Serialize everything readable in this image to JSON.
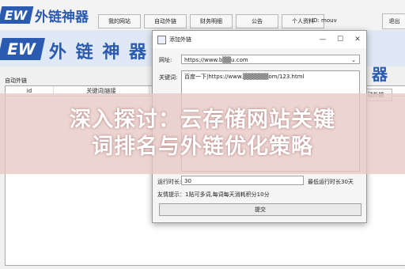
{
  "logo": {
    "badge": "EW",
    "text": "外链神器"
  },
  "tabs": [
    "我的网站",
    "自动外链",
    "财务明细",
    "公告",
    "个人资料"
  ],
  "user_id": "ID: mouv",
  "exit_label": "退出",
  "banner": {
    "badge": "EW",
    "text": "外 链 神 器",
    "right_text": "器"
  },
  "section_label": "自动外链",
  "grid": {
    "columns": [
      "id",
      "关键词|链接"
    ]
  },
  "right_button": "动外链",
  "dialog": {
    "title": "添加外链",
    "controls": [
      "—",
      "☐",
      "✕"
    ],
    "url_label": "网址:",
    "url_value": "https://www.b▒▒u.com",
    "keyword_label": "关键词:",
    "keyword_value": "百度一下|https://www.▒▒▒▒▒▒om/123.html",
    "time_label": "运行时长:",
    "time_value": "30",
    "max_note": "最低运行时长30天",
    "tip": "友情提示：1贴可多词,每词每天消耗积分10分",
    "submit": "提交"
  },
  "overlay": {
    "line1": "深入探讨：云存储网站关键",
    "line2": "词排名与外链优化策略"
  }
}
